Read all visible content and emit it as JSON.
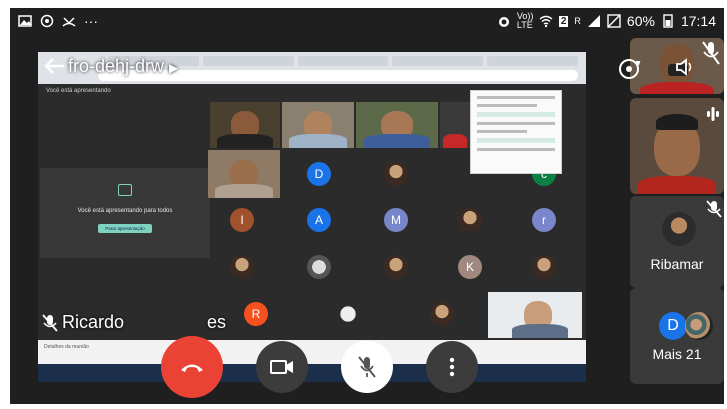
{
  "status_bar": {
    "volte": "Vo)) LTE",
    "network": "2",
    "signal_label": "R",
    "battery": "60%",
    "time": "17:14"
  },
  "meeting": {
    "code": "fro-dehj-drw",
    "presenting_text": "Você está apresentando",
    "present_card_text": "Você está apresentando para todos",
    "present_card_button": "Parar apresentação",
    "speaker_name": "Ricardo",
    "speaker_name_rest": "es",
    "bottom_strip_text": "Detalhes da reunião"
  },
  "grid_avatars": [
    {
      "letter": "D",
      "color": "#1a73e8"
    },
    {
      "letter": "I",
      "color": "#a0522d"
    },
    {
      "letter": "A",
      "color": "#1a73e8"
    },
    {
      "letter": "M",
      "color": "#7986cb"
    },
    {
      "letter": "r",
      "color": "#7986cb"
    },
    {
      "letter": "K",
      "color": "#a1887f"
    },
    {
      "letter": "R",
      "color": "#f4511e"
    },
    {
      "letter": "c",
      "color": "#0b8043"
    }
  ],
  "side_tiles": {
    "ribamar_name": "Ribamar",
    "more_label": "Mais 21",
    "more_avatar_letter": "D"
  },
  "colors": {
    "end_call": "#ea4335",
    "dark_button": "#3c3c3c",
    "accent": "#7dd3c0"
  }
}
